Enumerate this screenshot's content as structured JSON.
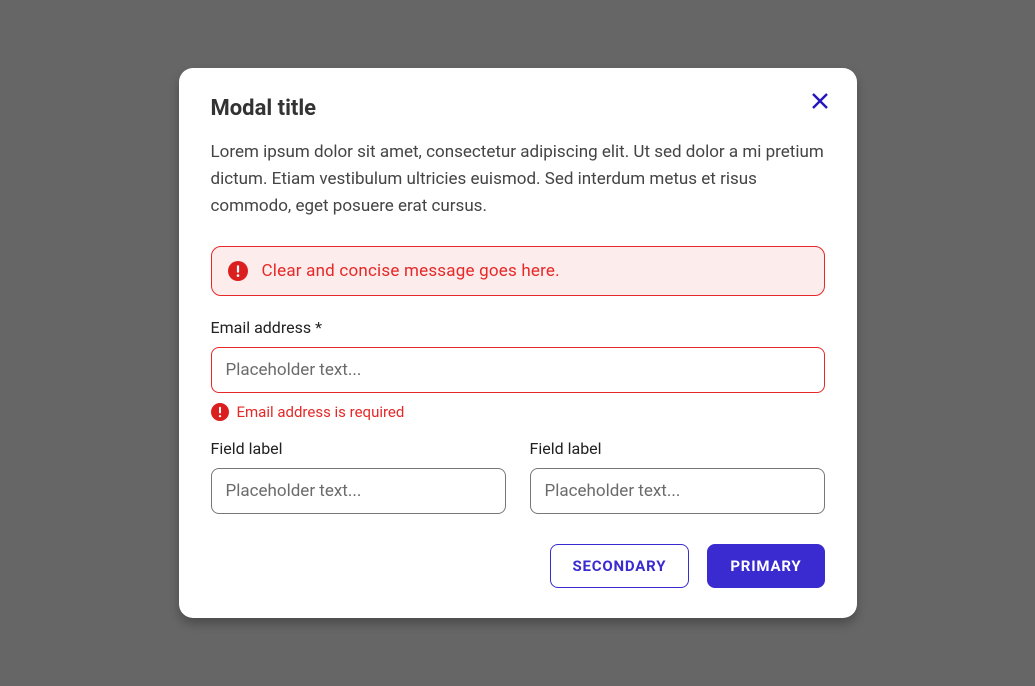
{
  "modal": {
    "title": "Modal title",
    "description": "Lorem ipsum dolor sit amet, consectetur adipiscing elit. Ut sed dolor a mi pretium dictum. Etiam vestibulum ultricies euismod. Sed interdum metus et risus commodo, eget posuere erat cursus.",
    "alert": {
      "message": "Clear and concise message goes here."
    },
    "fields": {
      "email": {
        "label": "Email address *",
        "placeholder": "Placeholder text...",
        "value": "",
        "error": "Email address is required"
      },
      "field_a": {
        "label": "Field label",
        "placeholder": "Placeholder text...",
        "value": ""
      },
      "field_b": {
        "label": "Field label",
        "placeholder": "Placeholder text...",
        "value": ""
      }
    },
    "buttons": {
      "secondary": "SECONDARY",
      "primary": "PRIMARY"
    }
  }
}
